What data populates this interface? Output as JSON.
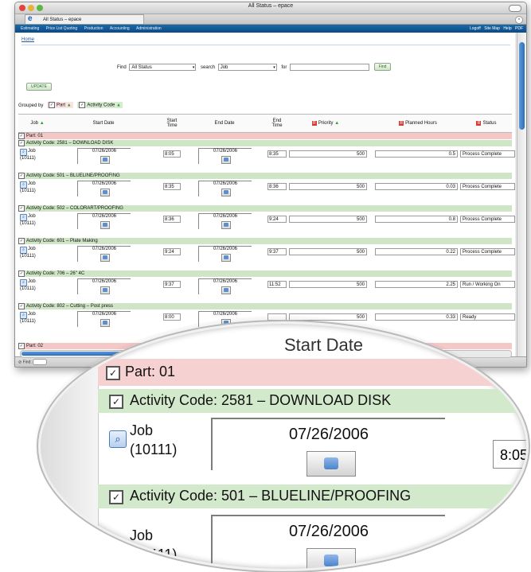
{
  "window": {
    "title": "All Status – epace"
  },
  "browser_tab": {
    "label": "All Status – epace"
  },
  "nav": {
    "items": [
      "Estimating",
      "Price List Quoting",
      "Production",
      "Accounting",
      "Administration"
    ],
    "util": [
      "Logoff",
      "Site Map",
      "Help",
      "PDF"
    ]
  },
  "page": {
    "home_link": "Home",
    "find_label": "Find",
    "find_value": "All Status",
    "search_label": "search",
    "search_value": "Job",
    "for_label": "for",
    "for_value": "",
    "find_button": "Find",
    "update_button": "UPDATE",
    "grouped_by_label": "Grouped by",
    "group_part": "Part",
    "group_activity": "Activity Code"
  },
  "table": {
    "headers": [
      "Job",
      "Start Date",
      "Start Time",
      "End Date",
      "End Time",
      "Priority",
      "Planned Hours",
      "Status"
    ],
    "part1": "Part: 01",
    "part2": "Part: 02",
    "groups": [
      {
        "activity": "Activity Code: 2581 – DOWNLOAD DISK",
        "job": "Job",
        "job_no": "(10111)",
        "start_date": "07/26/2006",
        "start_time": "8:05",
        "end_date": "07/26/2006",
        "end_time": "8:35",
        "priority": "500",
        "hours": "0.5",
        "status": "Process Complete"
      },
      {
        "activity": "Activity Code: 501 – BLUELINE/PROOFING",
        "job": "Job",
        "job_no": "(10111)",
        "start_date": "07/26/2006",
        "start_time": "8:35",
        "end_date": "07/26/2006",
        "end_time": "8:36",
        "priority": "500",
        "hours": "0.03",
        "status": "Process Complete"
      },
      {
        "activity": "Activity Code: 502 – COLORART/PROOFING",
        "job": "Job",
        "job_no": "(10111)",
        "start_date": "07/26/2006",
        "start_time": "8:36",
        "end_date": "07/26/2006",
        "end_time": "9:24",
        "priority": "500",
        "hours": "0.8",
        "status": "Process Complete"
      },
      {
        "activity": "Activity Code: 601 – Plate Making",
        "job": "Job",
        "job_no": "(10111)",
        "start_date": "07/26/2006",
        "start_time": "9:24",
        "end_date": "07/26/2006",
        "end_time": "9:37",
        "priority": "500",
        "hours": "0.22",
        "status": "Process Complete"
      },
      {
        "activity": "Activity Code: 706 – 26\" 4C",
        "job": "Job",
        "job_no": "(10111)",
        "start_date": "07/26/2006",
        "start_time": "9:37",
        "end_date": "07/26/2006",
        "end_time": "11:52",
        "priority": "500",
        "hours": "2.25",
        "status": "Run / Working On"
      },
      {
        "activity": "Activity Code: 802 – Cutting – Post press",
        "job": "Job",
        "job_no": "(10111)",
        "start_date": "07/26/2006",
        "start_time": "8:00",
        "end_date": "07/26/2006",
        "end_time": "",
        "priority": "500",
        "hours": "0.33",
        "status": "Ready"
      }
    ]
  },
  "statusbar": {
    "find_label": "Find:"
  },
  "magnified": {
    "header_fragment": "Start Date",
    "part": "Part: 01",
    "activity1": "Activity Code: 2581 – DOWNLOAD DISK",
    "activity2": "Activity Code: 501 – BLUELINE/PROOFING",
    "job": "Job",
    "job_no": "(10111)",
    "job_no_partial": "(10111)",
    "date1": "07/26/2006",
    "date2": "07/26/2006",
    "time1": "8:05"
  },
  "colors": {
    "part_row": "#f5c8c8",
    "activity_row": "#cfe6c6",
    "nav": "#0c4a86",
    "link": "#2857a8"
  }
}
